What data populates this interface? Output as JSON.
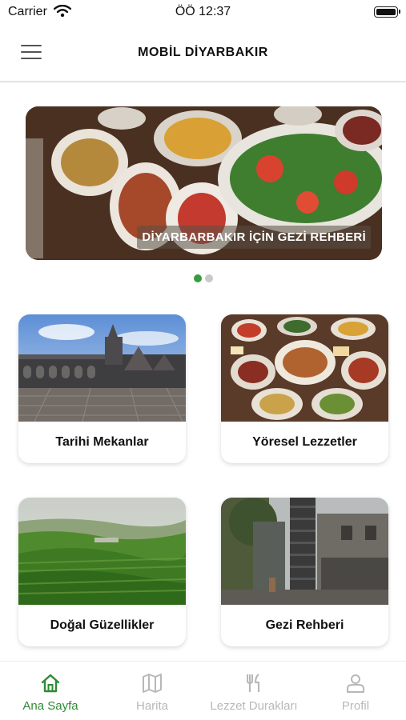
{
  "status_bar": {
    "carrier": "Carrier",
    "time": "ÖÖ 12:37"
  },
  "header": {
    "title": "MOBİL DİYARBAKIR",
    "menu_icon": "hamburger-menu-icon"
  },
  "carousel": {
    "caption": "DİYARBARBAKIR İÇİN GEZİ REHBERİ",
    "slides_count": 2,
    "active_index": 0
  },
  "categories": [
    {
      "label": "Tarihi Mekanlar",
      "image": "historic-mosque-courtyard"
    },
    {
      "label": "Yöresel Lezzetler",
      "image": "regional-breakfast-spread"
    },
    {
      "label": "Doğal Güzellikler",
      "image": "green-valley-landscape"
    },
    {
      "label": "Gezi Rehberi",
      "image": "old-town-street-tower"
    }
  ],
  "tabbar": {
    "items": [
      {
        "label": "Ana Sayfa",
        "icon": "home-icon",
        "active": true
      },
      {
        "label": "Harita",
        "icon": "map-icon",
        "active": false
      },
      {
        "label": "Lezzet Durakları",
        "icon": "fork-knife-icon",
        "active": false
      },
      {
        "label": "Profil",
        "icon": "person-icon",
        "active": false
      }
    ]
  },
  "colors": {
    "accent": "#2f8a34",
    "inactive": "#b8b8b8",
    "dot_active": "#3a9a3f",
    "dot_inactive": "#c9c9c9"
  }
}
